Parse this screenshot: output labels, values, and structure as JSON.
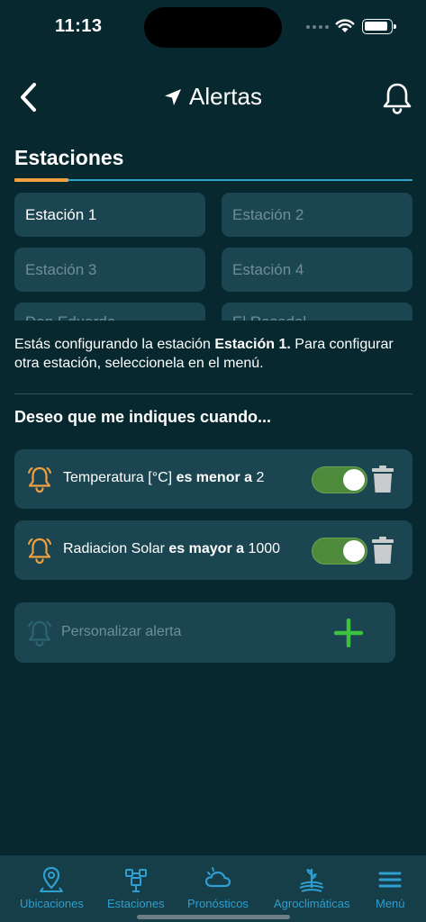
{
  "status_bar": {
    "time": "11:13"
  },
  "header": {
    "title": "Alertas"
  },
  "section": {
    "title": "Estaciones"
  },
  "stations": [
    {
      "label": "Estación 1"
    },
    {
      "label": "Estación 2"
    },
    {
      "label": "Estación 3"
    },
    {
      "label": "Estación 4"
    },
    {
      "label": "Don Eduardo"
    },
    {
      "label": "El Rosedal"
    }
  ],
  "selected_station": "Estación 1",
  "info": {
    "prefix": "Estás configurando la estación ",
    "station": "Estación 1.",
    "suffix": " Para configurar otra estación, seleccionela en el menú."
  },
  "alerts_heading": "Deseo que me indiques cuando...",
  "alerts": [
    {
      "variable": "Temperatura [°C]",
      "operator": "es menor a",
      "value": "2",
      "enabled": true
    },
    {
      "variable": "Radiacion Solar",
      "operator": "es mayor a",
      "value": "1000",
      "enabled": true
    }
  ],
  "custom_alert": {
    "label": "Personalizar alerta"
  },
  "bottom_nav": [
    {
      "label": "Ubicaciones",
      "icon": "location-pin-icon"
    },
    {
      "label": "Estaciones",
      "icon": "station-icon"
    },
    {
      "label": "Pronósticos",
      "icon": "cloud-icon"
    },
    {
      "label": "Agroclimáticas",
      "icon": "agro-icon"
    },
    {
      "label": "Menú",
      "icon": "menu-icon"
    }
  ],
  "colors": {
    "background": "#07282f",
    "card": "#1b4651",
    "accent_orange": "#f0a040",
    "accent_blue": "#2aa3c4",
    "toggle_on": "#4e8a3b",
    "plus_green": "#3cc23c",
    "nav_label": "#2e9fd0"
  }
}
